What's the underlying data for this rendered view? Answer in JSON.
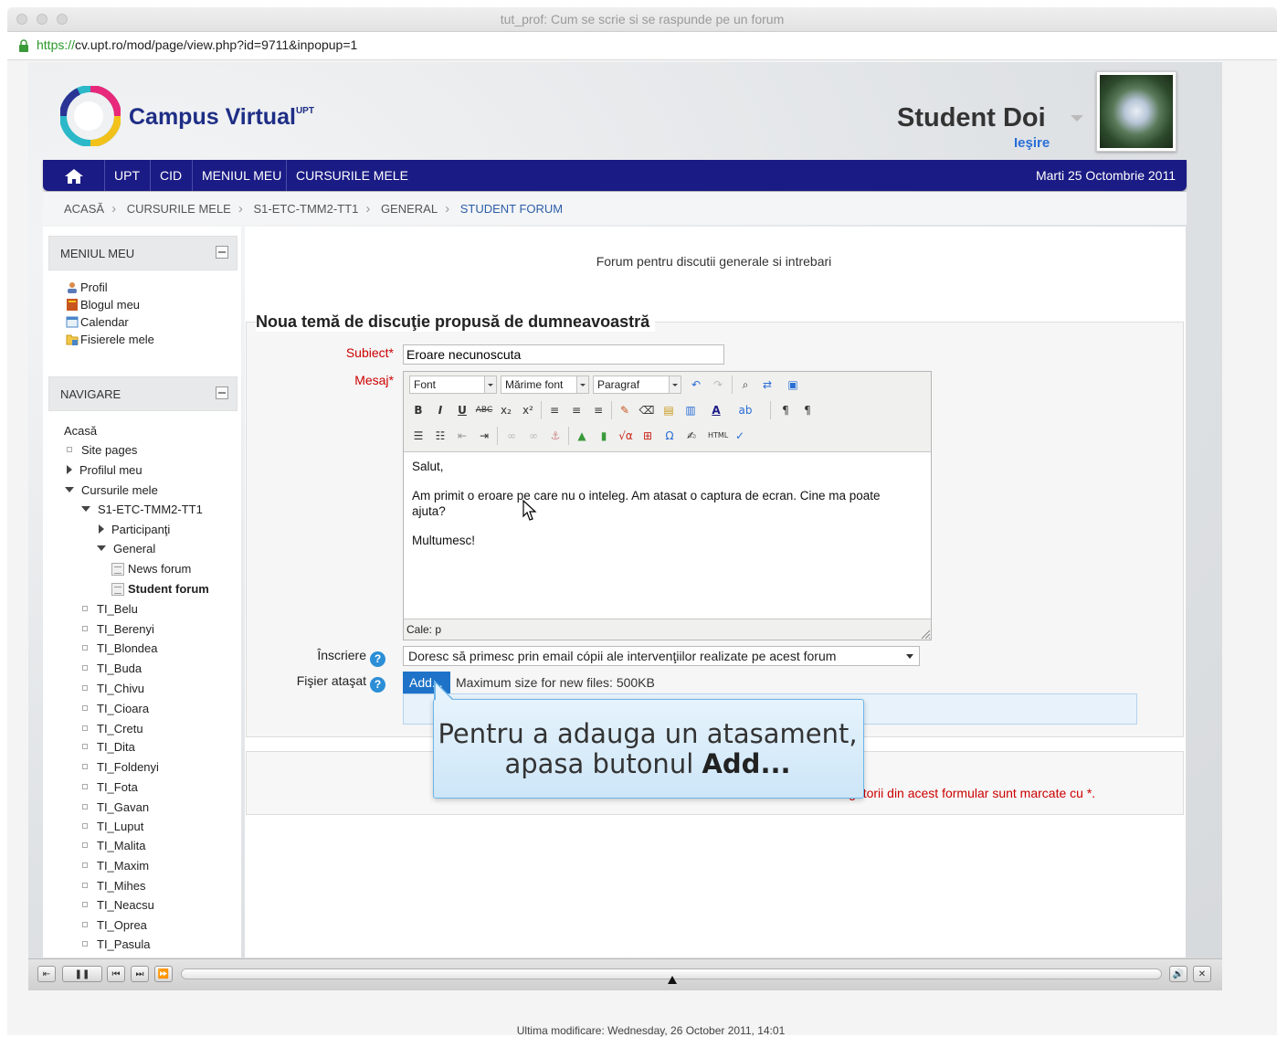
{
  "window": {
    "title": "tut_prof: Cum se scrie si se raspunde pe un forum",
    "url_protocol": "https://",
    "url_rest": "cv.upt.ro/mod/page/view.php?id=9711&inpopup=1"
  },
  "header": {
    "brand": "Campus Virtual",
    "brand_sup": "UPT",
    "user_name": "Student Doi",
    "logout": "Ieşire"
  },
  "nav": {
    "items": [
      "UPT",
      "CID",
      "MENIUL MEU",
      "CURSURILE MELE"
    ],
    "date": "Marti 25 Octombrie 2011"
  },
  "breadcrumb": [
    "ACASĂ",
    "CURSURILE MELE",
    "S1-ETC-TMM2-TT1",
    "GENERAL",
    "STUDENT FORUM"
  ],
  "sidebar": {
    "menu_title": "MENIUL MEU",
    "menu_items": [
      "Profil",
      "Blogul meu",
      "Calendar",
      "Fisierele mele"
    ],
    "nav_title": "NAVIGARE",
    "tree": {
      "home": "Acasă",
      "site_pages": "Site pages",
      "profile": "Profilul meu",
      "my_courses": "Cursurile mele",
      "course": "S1-ETC-TMM2-TT1",
      "participants": "Participanţi",
      "general": "General",
      "news_forum": "News forum",
      "student_forum": "Student forum",
      "courses": [
        "TI_Belu",
        "TI_Berenyi",
        "TI_Blondea",
        "TI_Buda",
        "TI_Chivu",
        "TI_Cioara",
        "TI_Cretu",
        "TI_Dita",
        "TI_Foldenyi",
        "TI_Fota",
        "TI_Gavan",
        "TI_Luput",
        "TI_Malita",
        "TI_Maxim",
        "TI_Mihes",
        "TI_Neacsu",
        "TI_Oprea",
        "TI_Pasula"
      ]
    }
  },
  "main": {
    "forum_description": "Forum pentru discutii generale si intrebari",
    "legend": "Noua temă de discuţie propusă de dumneavoastră",
    "subject_label": "Subiect",
    "subject_value": "Eroare necunoscuta",
    "message_label": "Mesaj",
    "toolbar": {
      "font": "Font",
      "font_size": "Mărime font",
      "paragraph": "Paragraf"
    },
    "message_lines": [
      "Salut,",
      "Am primit o eroare pe care nu o inteleg. Am atasat o captura de ecran. Cine ma poate",
      "ajuta?",
      "Multumesc!"
    ],
    "editor_path": "Cale: p",
    "subscription_label": "Înscriere",
    "subscription_value": "Doresc să primesc prin email cópii ale intervenţiilor realizate pe acest forum",
    "attachment_label": "Fişier ataşat",
    "add_button": "Add...",
    "max_size": "Maximum size for new files: 500KB",
    "required_note": "...e obligatorii din acest formular sunt marcate cu",
    "required_mark": "*."
  },
  "tooltip": {
    "line1": "Pentru a adauga un atasament,",
    "line2_prefix": "apasa butonul ",
    "line2_bold": "Add..."
  },
  "footer": {
    "text": "Ultima modificare: Wednesday, 26 October 2011, 14:01"
  },
  "colors": {
    "nav_bg": "#1a1b84",
    "link": "#2c5ea8",
    "required": "#cc0000",
    "tooltip_border": "#6cb6e8"
  }
}
